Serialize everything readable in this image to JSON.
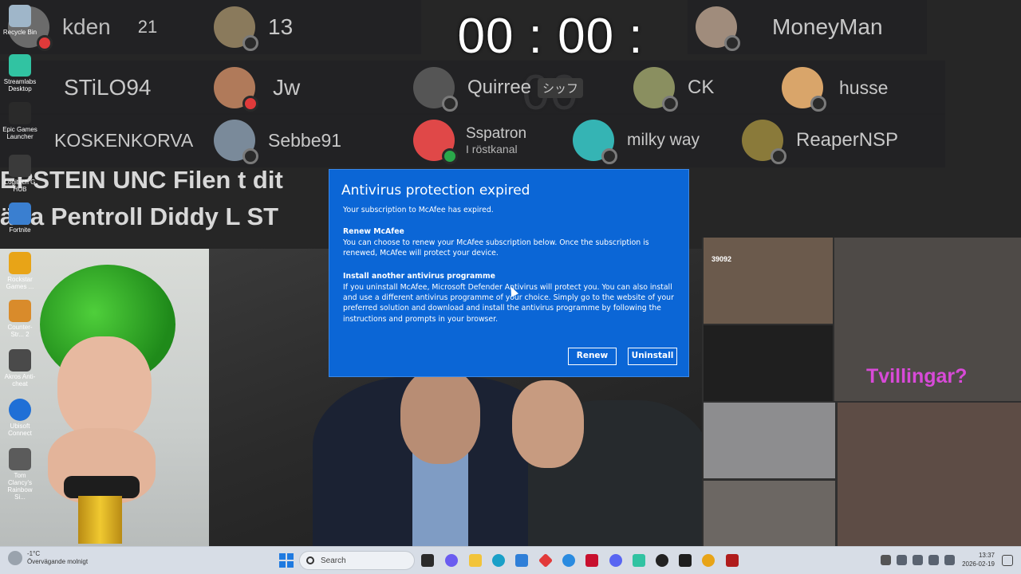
{
  "stream_timer": "00 : 00 : 00",
  "voice_overlay": {
    "row1": [
      {
        "name": "kden",
        "badge": "21",
        "muted": true,
        "color": "#6b6b6b"
      },
      {
        "name": "13",
        "muted": false,
        "color": "#8a7a5c"
      },
      {
        "name": "MoneyMan",
        "muted": false,
        "color": "#a08c7c"
      }
    ],
    "row2": [
      {
        "name": "STiLO94",
        "muted": false,
        "color": "#333333"
      },
      {
        "name": "Jw",
        "muted": true,
        "color": "#b07a5a"
      },
      {
        "name": "Quirree",
        "tag": "シッフ",
        "muted": false,
        "color": "#555555"
      },
      {
        "name": "CK",
        "muted": false,
        "color": "#8a8f60"
      },
      {
        "name": "husse",
        "muted": false,
        "color": "#d9a56a"
      }
    ],
    "row3": [
      {
        "name": "KOSKENKORVA",
        "muted": false,
        "color": "#333333"
      },
      {
        "name": "Sebbe91",
        "muted": false,
        "color": "#7a8a9a"
      },
      {
        "name": "Sspatron",
        "status": "I röstkanal",
        "muted": false,
        "color": "#e04848"
      },
      {
        "name": "milky way",
        "muted": false,
        "color": "#35b4b4"
      },
      {
        "name": "ReaperNSP",
        "muted": false,
        "color": "#8a7a3a"
      }
    ]
  },
  "ticker": {
    "line1": "EPSTEIN UNC  Filen t dit",
    "line2": "ärla Pentroll Diddy L ST"
  },
  "desktop_icons": [
    {
      "label": "Recycle Bin",
      "icon": "recycle-bin-icon",
      "color": "#9fb6c9"
    },
    {
      "label": "Streamlabs Desktop",
      "icon": "streamlabs-icon",
      "color": "#31c3a2"
    },
    {
      "label": "Epic Games Launcher",
      "icon": "epic-games-icon",
      "color": "#2a2a2a"
    },
    {
      "label": "Logitech G HUB",
      "icon": "logitech-icon",
      "color": "#3a3a3a"
    },
    {
      "label": "Fortnite",
      "icon": "fortnite-icon",
      "color": "#3a7fd0"
    },
    {
      "label": "Rockstar Games ...",
      "icon": "rockstar-icon",
      "color": "#e8a417"
    },
    {
      "label": "Counter-Str... 2",
      "icon": "counter-strike-icon",
      "color": "#d98b2b"
    },
    {
      "label": "Akros Anti-cheat",
      "icon": "akros-icon",
      "color": "#4a4a4a"
    },
    {
      "label": "Ubisoft Connect",
      "icon": "ubisoft-icon",
      "color": "#1f6fd6"
    },
    {
      "label": "Tom Clancy's Rainbow Si...",
      "icon": "rainbow-six-icon",
      "color": "#5b5b5b"
    }
  ],
  "dialog": {
    "title": "Antivirus protection expired",
    "intro": "Your subscription to McAfee has expired.",
    "section1_heading": "Renew McAfee",
    "section1_text": "You can choose to renew your McAfee subscription below. Once the subscription is renewed, McAfee will protect your device.",
    "section2_heading": "Install another antivirus programme",
    "section2_text": "If you uninstall McAfee, Microsoft Defender Antivirus will protect you. You can also install and use a different antivirus programme of your choice. Simply go to the website of your preferred solution and download and install the antivirus programme by following the instructions and prompts in your browser.",
    "renew_label": "Renew",
    "uninstall_label": "Uninstall",
    "background_color": "#0b66d6"
  },
  "webcam_overlay": {
    "donation_text": "39092",
    "caption": "Tvillingar?"
  },
  "taskbar": {
    "weather_temp": "-1°C",
    "weather_desc": "Övervägande molnigt",
    "search_placeholder": "Search",
    "time": "13:37",
    "date": "2026-02-19",
    "pinned_apps": [
      {
        "icon": "task-view-icon",
        "color": "#2b2b2b"
      },
      {
        "icon": "copilot-icon",
        "color": "#6a5cf0"
      },
      {
        "icon": "file-explorer-icon",
        "color": "#f2c43a"
      },
      {
        "icon": "edge-icon",
        "color": "#1aa0c8"
      },
      {
        "icon": "store-icon",
        "color": "#2f7fd8"
      },
      {
        "icon": "jetbrains-icon",
        "color": "#e23a3a"
      },
      {
        "icon": "help-icon",
        "color": "#2a8be0"
      },
      {
        "icon": "mcafee-icon",
        "color": "#c8102e"
      },
      {
        "icon": "discord-icon",
        "color": "#5865f2"
      },
      {
        "icon": "streamlabs-taskbar-icon",
        "color": "#31c3a2"
      },
      {
        "icon": "logitech-taskbar-icon",
        "color": "#222222"
      },
      {
        "icon": "terminal-icon",
        "color": "#1e1e1e"
      },
      {
        "icon": "chrome-icon",
        "color": "#e8a417"
      },
      {
        "icon": "shield-app-icon",
        "color": "#b01c1c"
      }
    ]
  }
}
